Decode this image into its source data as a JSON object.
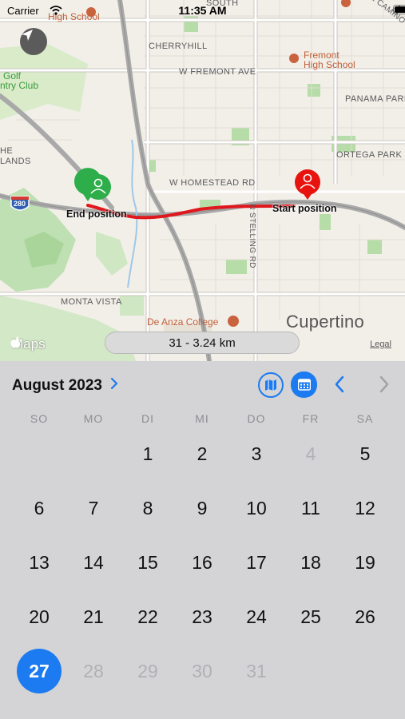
{
  "status_bar": {
    "carrier": "Carrier",
    "time": "11:35 AM"
  },
  "map": {
    "labels": {
      "high_school_1": "High School",
      "south": "SOUTH",
      "camino": "EL CAMINO RE",
      "cherryhill": "CHERRYHILL",
      "fremont_hs_1": "Fremont",
      "fremont_hs_2": "High School",
      "golf_1": "Golf",
      "golf_2": "ntry Club",
      "w_fremont": "W FREMONT AVE",
      "panama": "PANAMA PARK",
      "ortega": "ORTEGA PARK",
      "he": "HE",
      "lands": "LANDS",
      "w_homestead": "W HOMESTEAD RD",
      "highway": "280",
      "stelling": "N STELLING RD",
      "monta_vista": "MONTA VISTA",
      "de_anza": "De Anza College",
      "city": "Cupertino",
      "end_position": "End position",
      "start_position": "Start position"
    },
    "colors": {
      "route": "#e0171c",
      "start_pin": "#e8130f",
      "end_pin": "#2eae4a"
    },
    "maps_logo": "Maps",
    "legal": "Legal",
    "distance": "31 - 3.24 km"
  },
  "calendar": {
    "month_label": "August 2023",
    "accent": "#1c7bf0",
    "weekdays": [
      "SO",
      "MO",
      "DI",
      "MI",
      "DO",
      "FR",
      "SA"
    ],
    "weeks": [
      [
        null,
        null,
        "1",
        "2",
        "3",
        "4",
        "5"
      ],
      [
        "6",
        "7",
        "8",
        "9",
        "10",
        "11",
        "12"
      ],
      [
        "13",
        "14",
        "15",
        "16",
        "17",
        "18",
        "19"
      ],
      [
        "20",
        "21",
        "22",
        "23",
        "24",
        "25",
        "26"
      ],
      [
        "27",
        "28",
        "29",
        "30",
        "31",
        null,
        null
      ]
    ],
    "disabled_days": [
      "4",
      "28",
      "29",
      "30",
      "31"
    ],
    "selected_day": "27"
  }
}
